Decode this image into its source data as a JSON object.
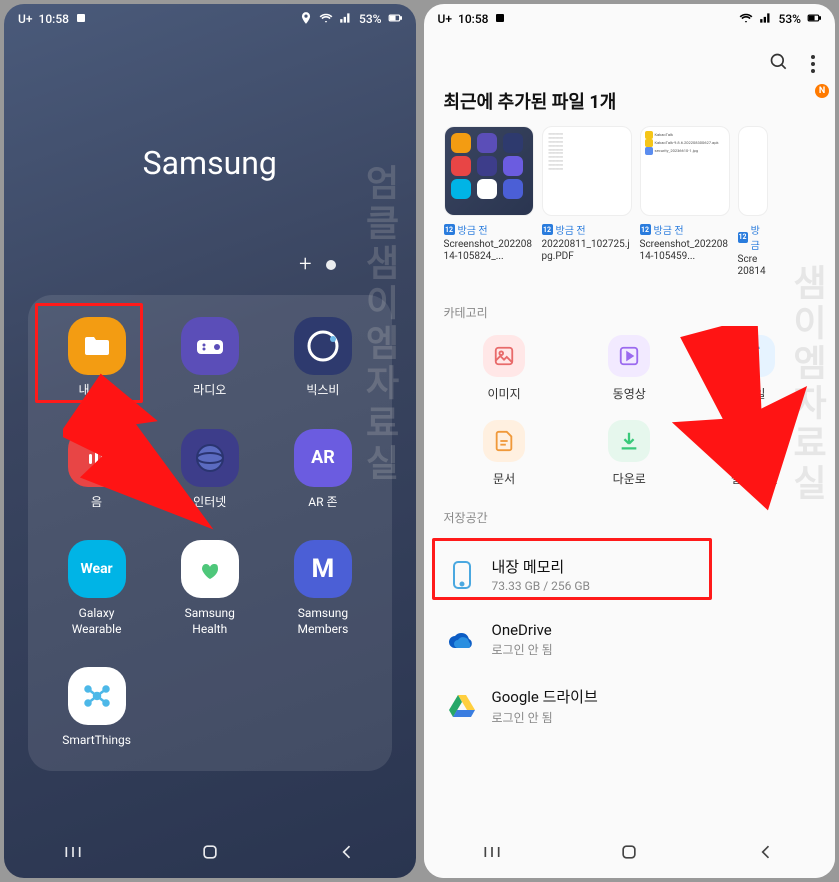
{
  "status": {
    "carrier": "U+",
    "time": "10:58",
    "battery": "53%"
  },
  "left": {
    "folder_title": "Samsung",
    "apps": [
      {
        "label": "내 파일"
      },
      {
        "label": "라디오"
      },
      {
        "label": "빅스비"
      },
      {
        "label": "음"
      },
      {
        "label": "인터넷"
      },
      {
        "label": "AR 존"
      },
      {
        "label": "Galaxy\nWearable"
      },
      {
        "label": "Samsung\nHealth"
      },
      {
        "label": "Samsung\nMembers"
      },
      {
        "label": "SmartThings"
      }
    ]
  },
  "right": {
    "recent_title": "최근에 추가된 파일 1개",
    "n_badge": "N",
    "recent": [
      {
        "time": "방금 전",
        "name": "Screenshot_20220814-105824_..."
      },
      {
        "time": "방금 전",
        "name": "20220811_102725.jpg.PDF"
      },
      {
        "time": "방금 전",
        "name": "Screenshot_20220814-105459..."
      },
      {
        "time": "방금",
        "name": "Scre\n20814"
      }
    ],
    "recent_doc_lines": [
      "KakaoTalk",
      "KakaoTalk-9.8.6.202208300627.apk",
      "security_20236610-1.jpg"
    ],
    "cat_header": "카테고리",
    "categories": [
      {
        "label": "이미지"
      },
      {
        "label": "동영상"
      },
      {
        "label": "파일"
      },
      {
        "label": "문서"
      },
      {
        "label": "다운로"
      },
      {
        "label": "설치 파일"
      }
    ],
    "storage_header": "저장공간",
    "storage": [
      {
        "title": "내장 메모리",
        "sub": "73.33 GB / 256 GB"
      },
      {
        "title": "OneDrive",
        "sub": "로그인 안 됨"
      },
      {
        "title": "Google 드라이브",
        "sub": "로그인 안 됨"
      }
    ]
  }
}
